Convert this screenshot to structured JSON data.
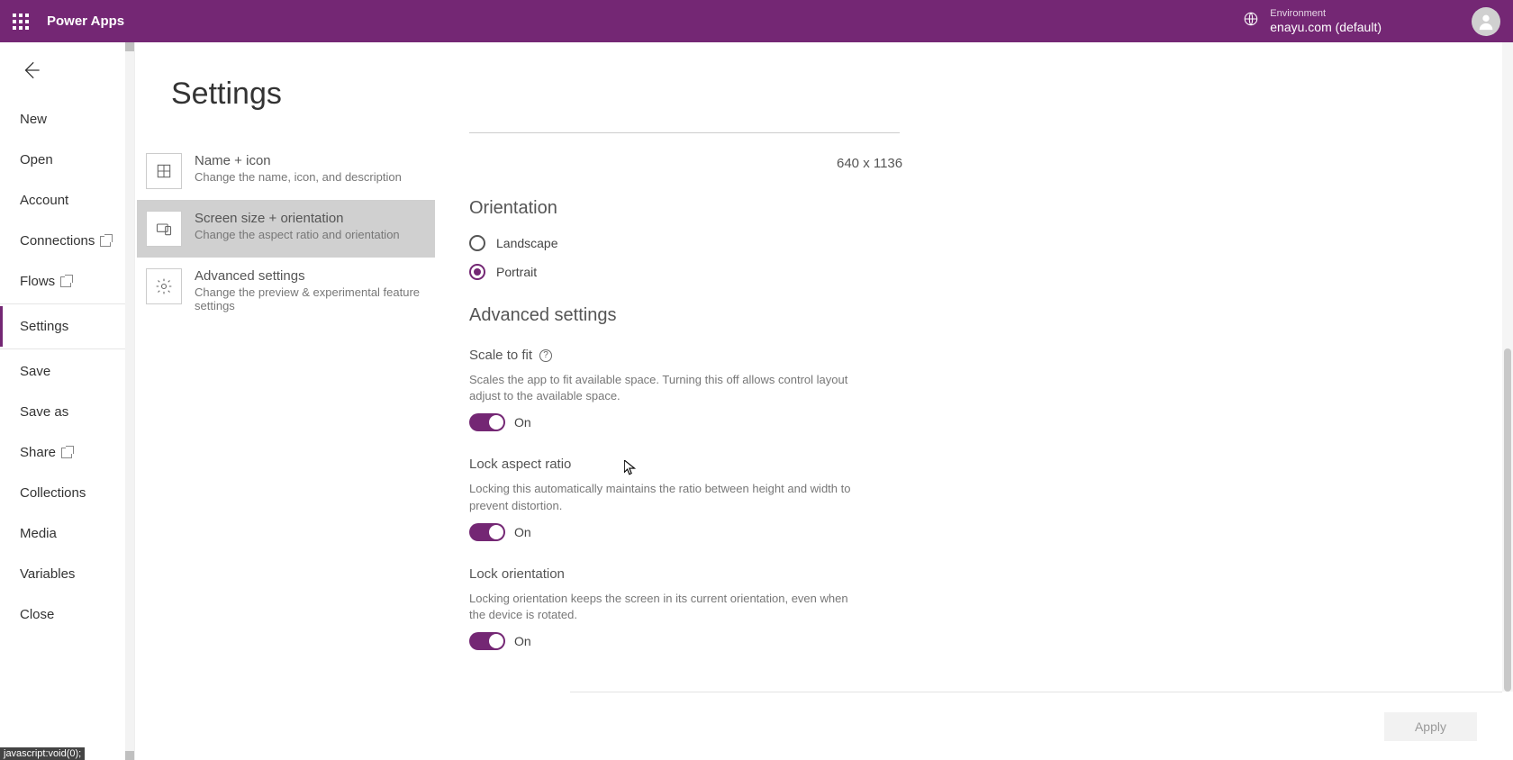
{
  "header": {
    "app_name": "Power Apps",
    "env_label": "Environment",
    "env_value": "enayu.com (default)"
  },
  "filemenu": {
    "items": [
      "New",
      "Open",
      "Account",
      "Connections",
      "Flows",
      "Settings",
      "Save",
      "Save as",
      "Share",
      "Collections",
      "Media",
      "Variables",
      "Close"
    ]
  },
  "page": {
    "title": "Settings"
  },
  "categories": [
    {
      "title": "Name + icon",
      "desc": "Change the name, icon, and description"
    },
    {
      "title": "Screen size + orientation",
      "desc": "Change the aspect ratio and orientation"
    },
    {
      "title": "Advanced settings",
      "desc": "Change the preview & experimental feature settings"
    }
  ],
  "detail": {
    "preview_dim": "640 x 1136",
    "orientation_h": "Orientation",
    "orientation_options": {
      "landscape": "Landscape",
      "portrait": "Portrait"
    },
    "advanced_h": "Advanced settings",
    "scale_title": "Scale to fit",
    "scale_desc": "Scales the app to fit available space. Turning this off allows control layout adjust to the available space.",
    "scale_state": "On",
    "lock_ratio_title": "Lock aspect ratio",
    "lock_ratio_desc": "Locking this automatically maintains the ratio between height and width to prevent distortion.",
    "lock_ratio_state": "On",
    "lock_orient_title": "Lock orientation",
    "lock_orient_desc": "Locking orientation keeps the screen in its current orientation, even when the device is rotated.",
    "lock_orient_state": "On"
  },
  "footer": {
    "apply": "Apply"
  },
  "status": "javascript:void(0);"
}
